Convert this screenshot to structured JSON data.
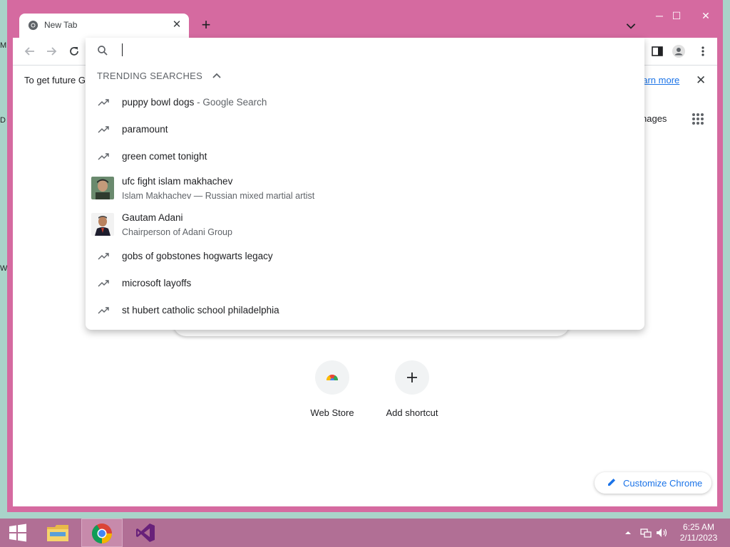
{
  "desktop": {
    "edge_glyphs": [
      "M",
      "D",
      "W"
    ]
  },
  "browser": {
    "tab": {
      "title": "New Tab"
    },
    "new_tab_label": "+",
    "window_controls": {
      "minimize": "─",
      "maximize": "☐",
      "close": "✕"
    },
    "infobar": {
      "text": "To get future G",
      "link": "earn more",
      "close": "✕"
    },
    "omnibox": {
      "value": "",
      "trending_header": "TRENDING SEARCHES",
      "suggestions": [
        {
          "text": "puppy bowl dogs",
          "suffix": " - Google Search",
          "sub": "",
          "icon": "trending-icon"
        },
        {
          "text": "paramount",
          "suffix": "",
          "sub": "",
          "icon": "trending-icon"
        },
        {
          "text": "green comet tonight",
          "suffix": "",
          "sub": "",
          "icon": "trending-icon"
        },
        {
          "text": "ufc fight islam makhachev",
          "suffix": "",
          "sub": "Islam Makhachev — Russian mixed martial artist",
          "icon": "entity-thumbnail"
        },
        {
          "text": "Gautam Adani",
          "suffix": "",
          "sub": "Chairperson of Adani Group",
          "icon": "entity-thumbnail"
        },
        {
          "text": "gobs of gobstones hogwarts legacy",
          "suffix": "",
          "sub": "",
          "icon": "trending-icon"
        },
        {
          "text": "microsoft layoffs",
          "suffix": "",
          "sub": "",
          "icon": "trending-icon"
        },
        {
          "text": "st hubert catholic school philadelphia",
          "suffix": "",
          "sub": "",
          "icon": "trending-icon"
        }
      ]
    },
    "ntp": {
      "images_link": "nages",
      "shortcuts": [
        {
          "label": "Web Store"
        },
        {
          "label": "Add shortcut"
        }
      ],
      "customize_label": "Customize Chrome"
    }
  },
  "taskbar": {
    "apps": [
      "start-button",
      "file-explorer",
      "chrome",
      "visual-studio"
    ],
    "clock": {
      "time": "6:25 AM",
      "date": "2/11/2023"
    }
  },
  "colors": {
    "window_frame": "#d56aa0",
    "taskbar": "#b16f95",
    "accent": "#1a73e8"
  }
}
